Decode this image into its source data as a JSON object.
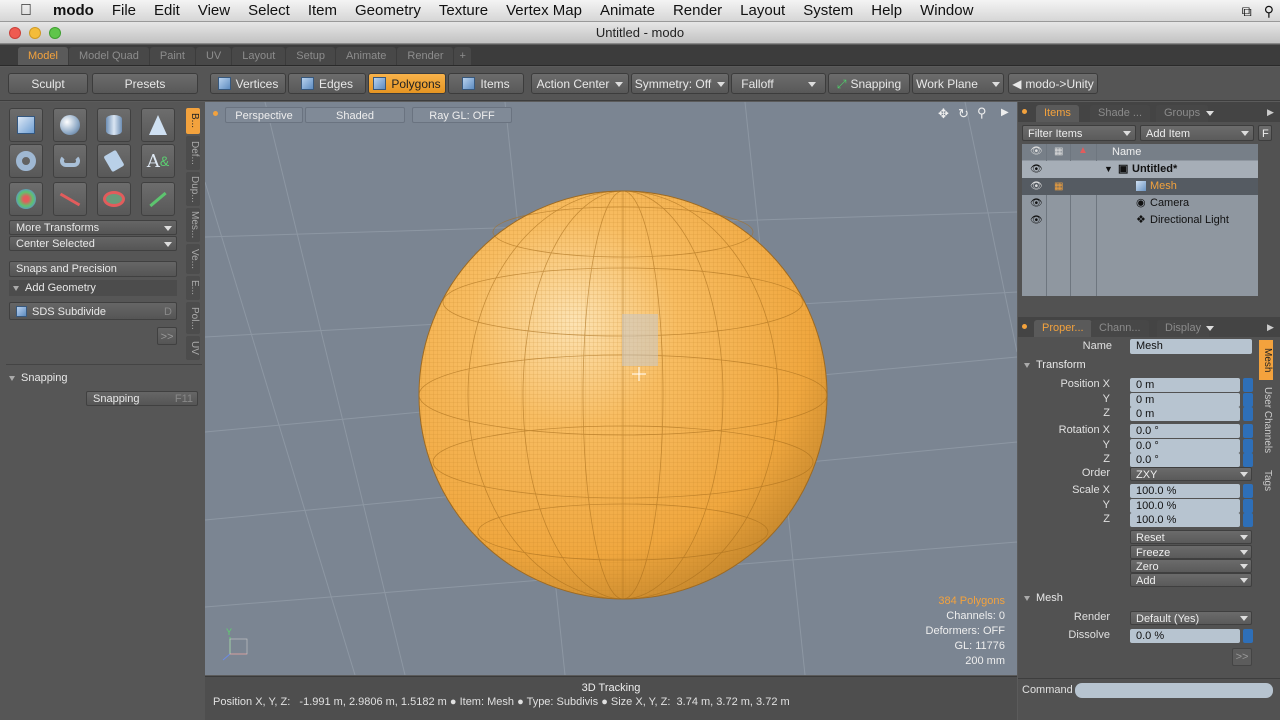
{
  "menubar": {
    "app": "modo",
    "items": [
      "File",
      "Edit",
      "View",
      "Select",
      "Item",
      "Geometry",
      "Texture",
      "Vertex Map",
      "Animate",
      "Render",
      "Layout",
      "System",
      "Help",
      "Window"
    ]
  },
  "window": {
    "title": "Untitled - modo"
  },
  "layout_tabs": [
    "Model",
    "Model Quad",
    "Paint",
    "UV",
    "Layout",
    "Setup",
    "Animate",
    "Render",
    "+"
  ],
  "toolbar": {
    "sculpt": "Sculpt",
    "presets": "Presets",
    "vertices": "Vertices",
    "edges": "Edges",
    "polygons": "Polygons",
    "items": "Items",
    "action_center": "Action Center",
    "symmetry": "Symmetry: Off",
    "falloff": "Falloff",
    "snapping": "Snapping",
    "work_plane": "Work Plane",
    "modo_unity": "modo->Unity"
  },
  "left_panel": {
    "more_transforms": "More Transforms",
    "center_selected": "Center Selected",
    "snaps_precision": "Snaps and Precision",
    "add_geometry": "Add Geometry",
    "sds_subdivide": "SDS Subdivide",
    "sds_shortcut": "D",
    "more": ">>",
    "snapping_section": "Snapping",
    "snapping_btn": "Snapping",
    "snapping_shortcut": "F11",
    "side_tabs": [
      "B...",
      "Def...",
      "Dup...",
      "Mes...",
      "Ve...",
      "E...",
      "Pol...",
      "UV"
    ]
  },
  "viewport": {
    "perspective": "Perspective",
    "shaded": "Shaded",
    "raygl": "Ray GL: OFF",
    "info": {
      "polygons": "384 Polygons",
      "channels": "Channels: 0",
      "deformers": "Deformers: OFF",
      "gl": "GL: 11776",
      "scale": "200 mm"
    },
    "axis_y": "Y"
  },
  "status": {
    "title": "3D Tracking",
    "position_label": "Position X, Y, Z:",
    "position_value": "-1.991 m, 2.9806 m, 1.5182 m",
    "item_label": "Item:",
    "item_value": "Mesh",
    "type_label": "Type:",
    "type_value": "Subdivis",
    "size_label": "Size X, Y, Z:",
    "size_value": "3.74 m, 3.72 m, 3.72 m"
  },
  "items_panel": {
    "tabs": [
      "Items",
      "Shade ...",
      "Groups"
    ],
    "filter": "Filter Items",
    "add": "Add Item",
    "f": "F",
    "col_name": "Name",
    "rows": [
      "Untitled*",
      "Mesh",
      "Camera",
      "Directional Light"
    ]
  },
  "properties": {
    "tabs": [
      "Proper...",
      "Chann...",
      "Display"
    ],
    "side_tabs": [
      "Mesh",
      "User Channels",
      "Tags"
    ],
    "name_label": "Name",
    "name_value": "Mesh",
    "transform": "Transform",
    "pos_label": "Position X",
    "pos": [
      "0 m",
      "0 m",
      "0 m"
    ],
    "rot_label": "Rotation X",
    "rot": [
      "0.0 °",
      "0.0 °",
      "0.0 °"
    ],
    "order_label": "Order",
    "order": "ZXY",
    "scale_label": "Scale X",
    "scale": [
      "100.0 %",
      "100.0 %",
      "100.0 %"
    ],
    "y": "Y",
    "z": "Z",
    "actions": [
      "Reset",
      "Freeze",
      "Zero",
      "Add"
    ],
    "mesh_section": "Mesh",
    "render_label": "Render",
    "render_value": "Default (Yes)",
    "dissolve_label": "Dissolve",
    "dissolve_value": "0.0 %",
    "more": ">>"
  },
  "command": {
    "label": "Command"
  },
  "colors": {
    "accent": "#f3a23d",
    "viewport": "#7b8592",
    "mesh": "#f6b552"
  }
}
